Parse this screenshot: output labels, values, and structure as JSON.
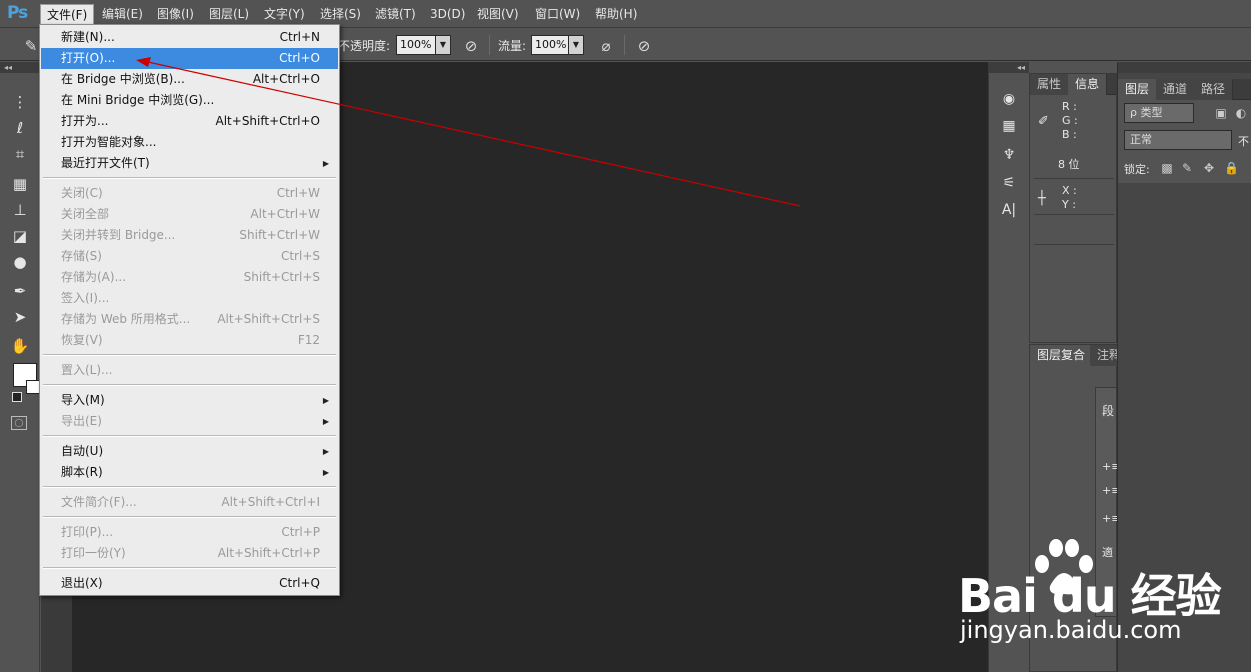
{
  "app": {
    "logo": "Ps"
  },
  "menubar": {
    "items": [
      "文件(F)",
      "编辑(E)",
      "图像(I)",
      "图层(L)",
      "文字(Y)",
      "选择(S)",
      "滤镜(T)",
      "3D(D)",
      "视图(V)",
      "窗口(W)",
      "帮助(H)"
    ],
    "active_index": 0
  },
  "options_bar": {
    "opacity_label": "不透明度:",
    "opacity_value": "100%",
    "flow_label": "流量:",
    "flow_value": "100%",
    "dropdown_glyph": "▼"
  },
  "file_menu": {
    "items": [
      {
        "label": "新建(N)...",
        "shortcut": "Ctrl+N",
        "enabled": true
      },
      {
        "label": "打开(O)...",
        "shortcut": "Ctrl+O",
        "enabled": true,
        "highlighted": true
      },
      {
        "label": "在 Bridge 中浏览(B)...",
        "shortcut": "Alt+Ctrl+O",
        "enabled": true
      },
      {
        "label": "在 Mini Bridge 中浏览(G)...",
        "shortcut": "",
        "enabled": true
      },
      {
        "label": "打开为...",
        "shortcut": "Alt+Shift+Ctrl+O",
        "enabled": true
      },
      {
        "label": "打开为智能对象...",
        "shortcut": "",
        "enabled": true
      },
      {
        "label": "最近打开文件(T)",
        "shortcut": "",
        "enabled": true,
        "submenu": true
      },
      {
        "label": "关闭(C)",
        "shortcut": "Ctrl+W",
        "enabled": false
      },
      {
        "label": "关闭全部",
        "shortcut": "Alt+Ctrl+W",
        "enabled": false
      },
      {
        "label": "关闭并转到 Bridge...",
        "shortcut": "Shift+Ctrl+W",
        "enabled": false
      },
      {
        "label": "存储(S)",
        "shortcut": "Ctrl+S",
        "enabled": false
      },
      {
        "label": "存储为(A)...",
        "shortcut": "Shift+Ctrl+S",
        "enabled": false
      },
      {
        "label": "签入(I)...",
        "shortcut": "",
        "enabled": false
      },
      {
        "label": "存储为 Web 所用格式...",
        "shortcut": "Alt+Shift+Ctrl+S",
        "enabled": false
      },
      {
        "label": "恢复(V)",
        "shortcut": "F12",
        "enabled": false
      },
      {
        "label": "置入(L)...",
        "shortcut": "",
        "enabled": false
      },
      {
        "label": "导入(M)",
        "shortcut": "",
        "enabled": true,
        "submenu": true
      },
      {
        "label": "导出(E)",
        "shortcut": "",
        "enabled": false,
        "submenu": true
      },
      {
        "label": "自动(U)",
        "shortcut": "",
        "enabled": true,
        "submenu": true
      },
      {
        "label": "脚本(R)",
        "shortcut": "",
        "enabled": true,
        "submenu": true
      },
      {
        "label": "文件简介(F)...",
        "shortcut": "Alt+Shift+Ctrl+I",
        "enabled": false
      },
      {
        "label": "打印(P)...",
        "shortcut": "Ctrl+P",
        "enabled": false
      },
      {
        "label": "打印一份(Y)",
        "shortcut": "Alt+Shift+Ctrl+P",
        "enabled": false
      },
      {
        "label": "退出(X)",
        "shortcut": "Ctrl+Q",
        "enabled": true
      }
    ],
    "separators_after": [
      6,
      14,
      15,
      17,
      19,
      20,
      22
    ],
    "submenu_glyph": "▶"
  },
  "info_panel": {
    "tabs": [
      "属性",
      "信息"
    ],
    "active_tab": 1,
    "rgb_labels": [
      "R :",
      "G :",
      "B :"
    ],
    "bit_depth": "8 位",
    "xy_labels": [
      "X :",
      "Y :"
    ]
  },
  "comps_panel": {
    "tabs": [
      "图层复合",
      "注释"
    ],
    "paragraph_tab": "段",
    "paragraph_glyphs": [
      "+≡",
      "+≡",
      "+≡",
      "適"
    ]
  },
  "layers_panel": {
    "tabs": [
      "图层",
      "通道",
      "路径"
    ],
    "active_tab": 0,
    "filter_kind": "ρ 类型",
    "blend_mode": "正常",
    "opacity_cut": "不",
    "lock_label": "锁定:"
  },
  "watermark": {
    "logo_text": "Bai du 经验",
    "url": "jingyan.baidu.com"
  },
  "colors": {
    "accent_highlight": "#3c8be0",
    "annotation_arrow": "#cc0000",
    "ps_blue": "#4aa3df"
  }
}
